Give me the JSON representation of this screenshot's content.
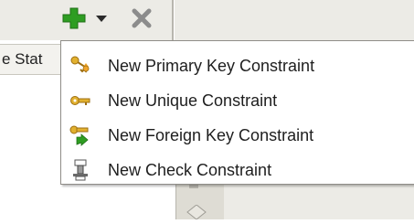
{
  "grid": {
    "header_fragment": "e Stat"
  },
  "toolbar": {
    "add_icon": "green-plus-icon",
    "dropdown_icon": "chevron-down-icon",
    "remove_icon": "gray-x-icon"
  },
  "menu": {
    "items": [
      {
        "label": "New Primary Key Constraint",
        "icon": "primary-key-icon"
      },
      {
        "label": "New Unique Constraint",
        "icon": "unique-key-icon"
      },
      {
        "label": "New Foreign Key Constraint",
        "icon": "foreign-key-icon"
      },
      {
        "label": "New Check Constraint",
        "icon": "check-constraint-icon"
      }
    ]
  },
  "colors": {
    "add_green": "#2e9d22",
    "remove_gray": "#8c8c8c",
    "key_gold": "#e2b12f",
    "menu_border": "#8f8d88"
  }
}
